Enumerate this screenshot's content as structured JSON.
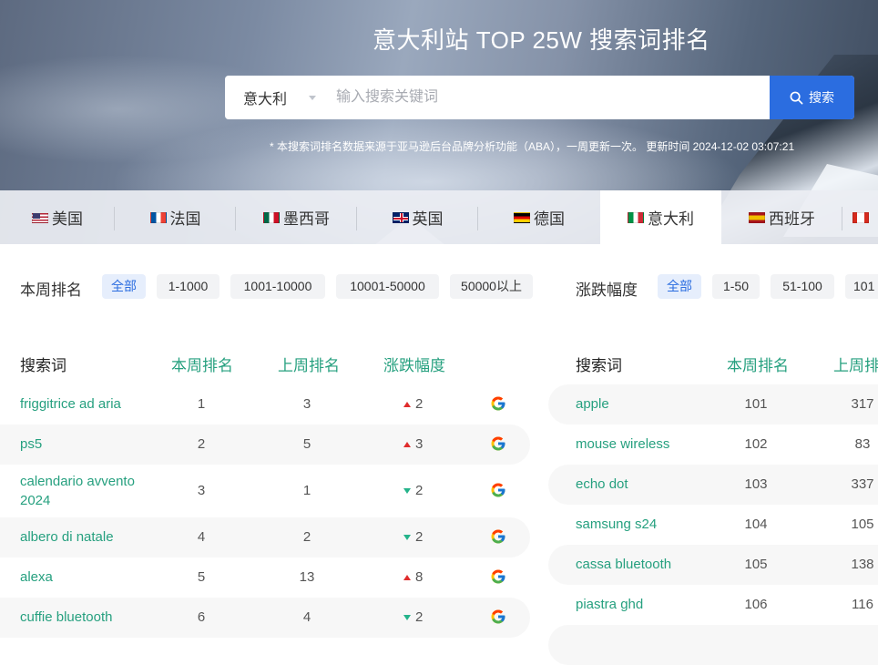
{
  "header": {
    "title": "意大利站 TOP 25W 搜索词排名",
    "search": {
      "market": "意大利",
      "placeholder": "输入搜索关键词",
      "button": "搜索"
    },
    "note": "* 本搜索词排名数据来源于亚马逊后台品牌分析功能（ABA），一周更新一次。 更新时间 2024-12-02 03:07:21"
  },
  "tabs": [
    {
      "label": "美国",
      "flag": "us"
    },
    {
      "label": "法国",
      "flag": "fr"
    },
    {
      "label": "墨西哥",
      "flag": "mx"
    },
    {
      "label": "英国",
      "flag": "gb"
    },
    {
      "label": "德国",
      "flag": "de"
    },
    {
      "label": "意大利",
      "flag": "it",
      "active": true
    },
    {
      "label": "西班牙",
      "flag": "es"
    },
    {
      "label": "",
      "flag": "ca"
    }
  ],
  "filters": {
    "rank_label": "本周排名",
    "rank_options": [
      "全部",
      "1-1000",
      "1001-10000",
      "10001-50000",
      "50000以上"
    ],
    "change_label": "涨跌幅度",
    "change_options": [
      "全部",
      "1-50",
      "51-100",
      "101"
    ]
  },
  "table_headers": {
    "keyword": "搜索词",
    "this_week": "本周排名",
    "last_week": "上周排名",
    "change": "涨跌幅度"
  },
  "left_rows": [
    {
      "keyword": "friggitrice ad aria",
      "this_week": "1",
      "last_week": "3",
      "change": "2",
      "dir": "up"
    },
    {
      "keyword": "ps5",
      "this_week": "2",
      "last_week": "5",
      "change": "3",
      "dir": "up"
    },
    {
      "keyword": "calendario avvento 2024",
      "this_week": "3",
      "last_week": "1",
      "change": "2",
      "dir": "down"
    },
    {
      "keyword": "albero di natale",
      "this_week": "4",
      "last_week": "2",
      "change": "2",
      "dir": "down"
    },
    {
      "keyword": "alexa",
      "this_week": "5",
      "last_week": "13",
      "change": "8",
      "dir": "up"
    },
    {
      "keyword": "cuffie bluetooth",
      "this_week": "6",
      "last_week": "4",
      "change": "2",
      "dir": "down"
    }
  ],
  "right_rows": [
    {
      "keyword": "apple",
      "this_week": "101",
      "last_week": "317"
    },
    {
      "keyword": "mouse wireless",
      "this_week": "102",
      "last_week": "83"
    },
    {
      "keyword": "echo dot",
      "this_week": "103",
      "last_week": "337"
    },
    {
      "keyword": "samsung s24",
      "this_week": "104",
      "last_week": "105"
    },
    {
      "keyword": "cassa bluetooth",
      "this_week": "105",
      "last_week": "138"
    },
    {
      "keyword": "piastra ghd",
      "this_week": "106",
      "last_week": "116"
    }
  ],
  "colors": {
    "accent": "#2b6de0",
    "keyword": "#26a07f",
    "up": "#e02c2c",
    "down": "#24b38a"
  }
}
